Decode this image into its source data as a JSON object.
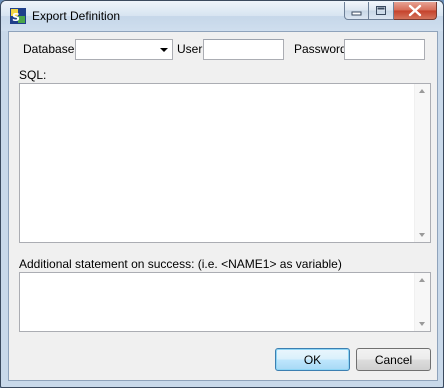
{
  "window": {
    "title": "Export Definition",
    "icon": "app-icon"
  },
  "titlebar_buttons": {
    "minimize": "minimize-icon",
    "maximize": "maximize-icon",
    "close": "close-icon"
  },
  "form": {
    "database_label": "Database:",
    "database_value": "",
    "user_label": "User",
    "user_value": "",
    "password_label": "Password",
    "password_value": "",
    "sql_label": "SQL:",
    "sql_value": "",
    "additional_label": "Additional statement on success: (i.e. <NAME1> as variable)",
    "additional_value": ""
  },
  "buttons": {
    "ok": "OK",
    "cancel": "Cancel"
  }
}
